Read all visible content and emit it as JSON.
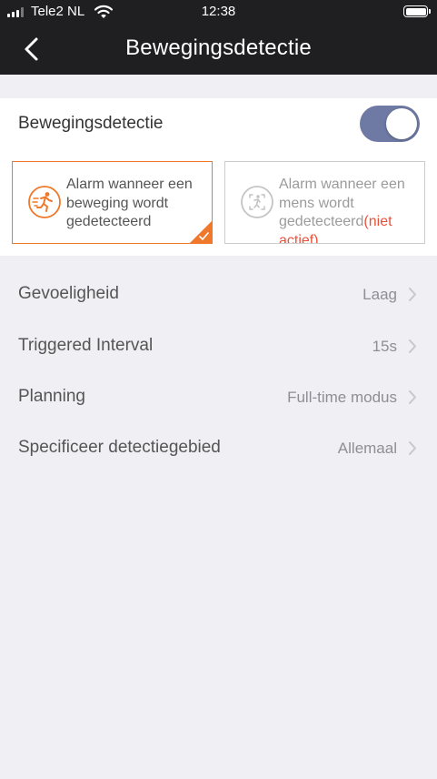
{
  "status": {
    "carrier": "Tele2 NL",
    "time": "12:38"
  },
  "nav": {
    "title": "Bewegingsdetectie"
  },
  "motion": {
    "label": "Bewegingsdetectie",
    "enabled": true,
    "options": [
      {
        "text": "Alarm wanneer een beweging wordt gedetecteerd",
        "selected": true
      },
      {
        "text": "Alarm wanneer een mens wordt gedetecteerd",
        "note": "(niet actief)",
        "selected": false
      }
    ]
  },
  "settings": [
    {
      "label": "Gevoeligheid",
      "value": "Laag"
    },
    {
      "label": "Triggered Interval",
      "value": "15s"
    },
    {
      "label": "Planning",
      "value": "Full-time modus"
    },
    {
      "label": "Specificeer detectiegebied",
      "value": "Allemaal"
    }
  ],
  "colors": {
    "accent": "#f0782b",
    "toggle": "#6e7aa3",
    "inactive_note": "#e8523b",
    "bar": "#1f1f21",
    "background": "#efeff4"
  }
}
